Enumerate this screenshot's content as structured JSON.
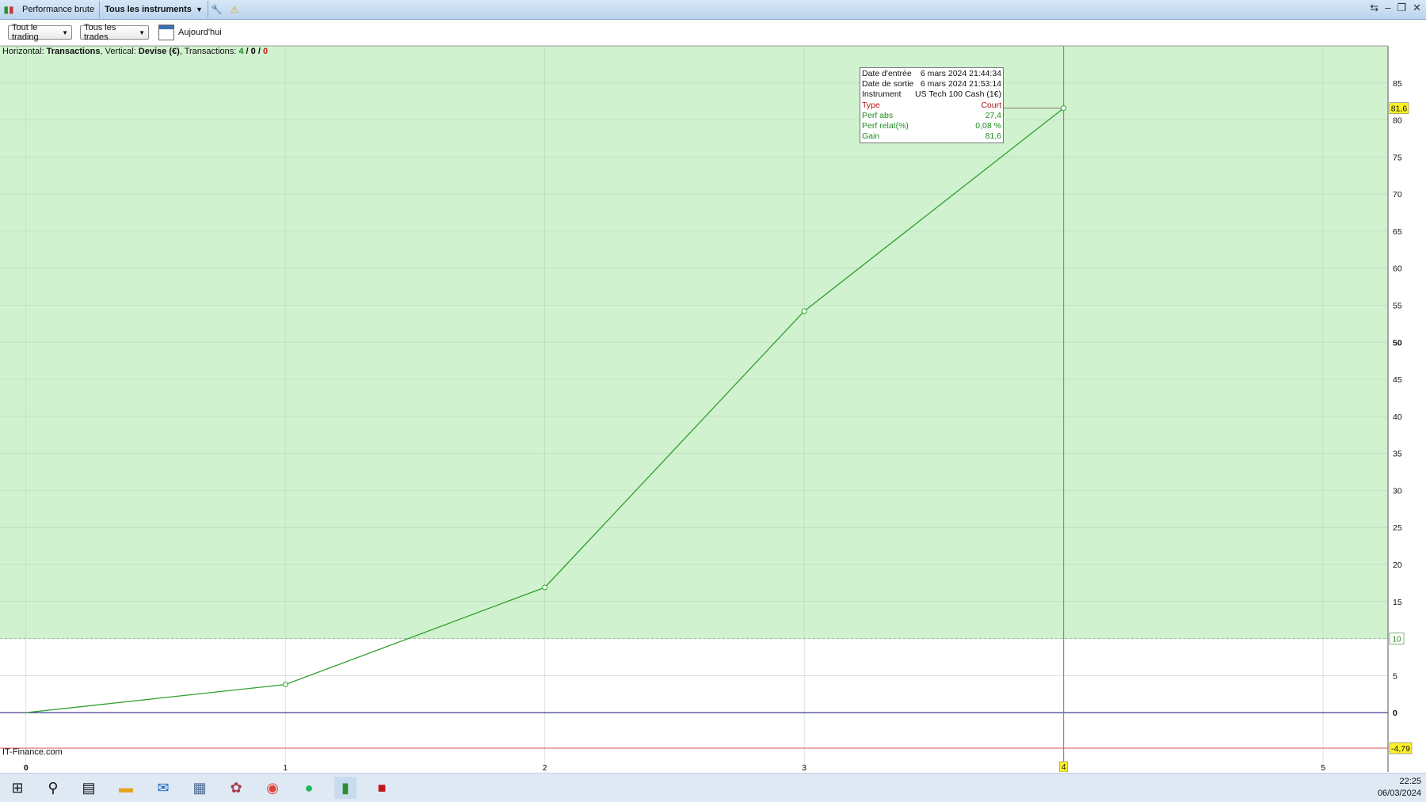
{
  "titlebar": {
    "tab_performance": "Performance brute",
    "tab_instruments": "Tous les instruments"
  },
  "toolbar": {
    "dropdown_trading": "Tout le trading",
    "dropdown_trades": "Tous les trades",
    "date_label": "Aujourd'hui"
  },
  "info": {
    "prefix": "Horizontal: ",
    "horizontal_value": "Transactions",
    "mid1": ", Vertical: ",
    "vertical_value": "Devise (€)",
    "mid2": ", Transactions: ",
    "count_green": "4",
    "sep1": " / ",
    "count_black": "0",
    "sep2": " / ",
    "count_red": "0"
  },
  "watermark": "IT-Finance.com",
  "tooltip": {
    "rows": [
      {
        "label": "Date d'entrée",
        "value": "6 mars 2024 21:44:34"
      },
      {
        "label": "Date de sortie",
        "value": "6 mars 2024 21:53:14"
      },
      {
        "label": "Instrument",
        "value": "US Tech 100 Cash (1€)"
      },
      {
        "label": "Type",
        "value": "Court"
      },
      {
        "label": "Perf abs",
        "value": "27,4"
      },
      {
        "label": "Perf relat(%)",
        "value": "0,08 %"
      },
      {
        "label": "Gain",
        "value": "81,6"
      }
    ]
  },
  "chart_data": {
    "type": "line",
    "x": [
      0,
      1,
      2,
      3,
      4
    ],
    "y": [
      0,
      3.8,
      16.9,
      54.2,
      81.6
    ],
    "xlim": [
      -0.1,
      5.25
    ],
    "ylim": [
      -8,
      90
    ],
    "x_ticks": [
      "0",
      "1",
      "2",
      "3",
      "4",
      "5"
    ],
    "y_ticks": [
      "0",
      "5",
      "10",
      "15",
      "20",
      "25",
      "30",
      "35",
      "40",
      "45",
      "50",
      "55",
      "60",
      "65",
      "70",
      "75",
      "80",
      "85"
    ],
    "threshold": 10,
    "threshold_label": "10",
    "min_line": -4.79,
    "min_label": "-4,79",
    "cursor_x": 4,
    "cursor_label": "4",
    "cursor_value_label": "81,6",
    "grid": true,
    "colors": {
      "line": "#2ea02e",
      "fill_zone": "#d1f2cf",
      "cursor": "#d9534f",
      "zero": "#3b3b8f",
      "min_line": "#d9534f",
      "highlight": "#fdf22a"
    }
  },
  "taskbar": {
    "icons": [
      "windows-start-icon",
      "search-icon",
      "task-view-icon",
      "file-explorer-icon",
      "mail-icon",
      "calculator-icon",
      "game-icon",
      "chrome-icon",
      "spotify-icon",
      "trading-app-icon",
      "pdf-icon"
    ],
    "time": "22:25",
    "date": "06/03/2024"
  }
}
